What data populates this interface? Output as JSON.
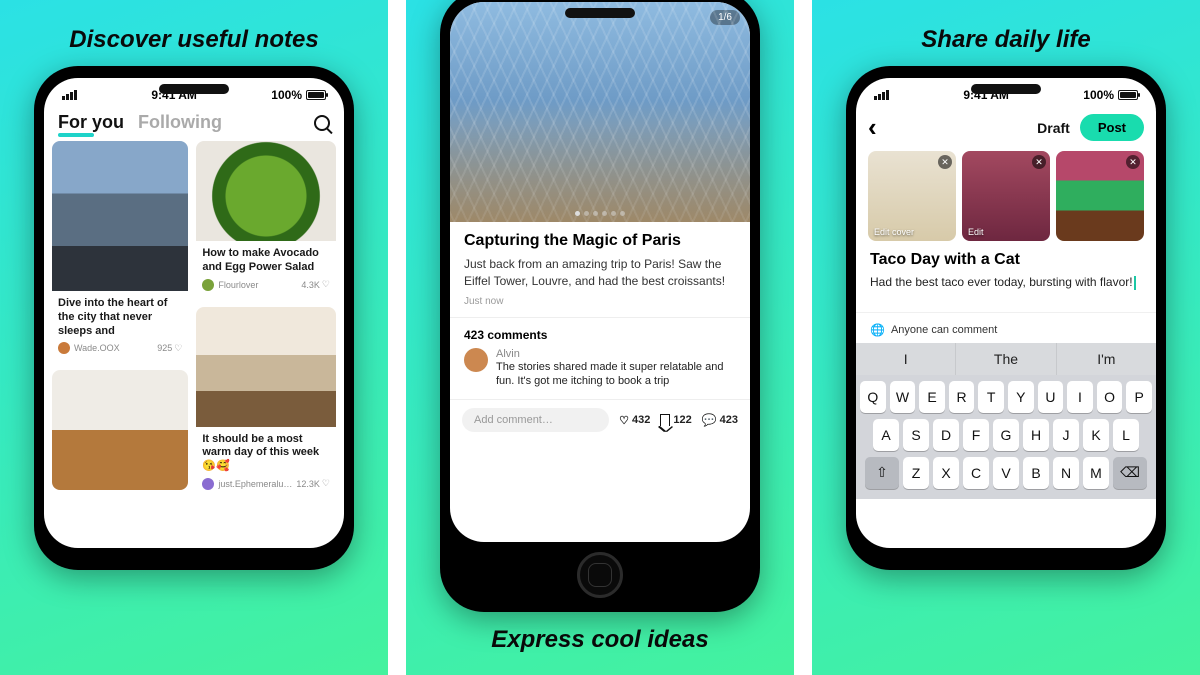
{
  "panels": {
    "left_headline": "Discover useful notes",
    "mid_headline": "Express cool ideas",
    "right_headline": "Share daily life"
  },
  "status": {
    "time": "9:41 AM",
    "battery": "100%"
  },
  "screen1": {
    "tabs": {
      "active": "For you",
      "inactive": "Following"
    },
    "cards": {
      "city": {
        "title": "Dive into the heart of the city that never sleeps and",
        "user": "Wade.OOX",
        "likes": "925"
      },
      "salad": {
        "title": "How to make Avocado and Egg Power Salad",
        "user": "Flourlover",
        "likes": "4.3K"
      },
      "room": {
        "title": "It should be a most warm day of this week 😘🥰",
        "user": "just.Ephemeralu…",
        "likes": "12.3K"
      }
    }
  },
  "screen2": {
    "counter": "1/6",
    "title": "Capturing the Magic of Paris",
    "text": "Just back from an amazing trip to Paris! Saw the Eiffel Tower, Louvre, and had the best croissants!",
    "time": "Just now",
    "comments_label": "423 comments",
    "comment": {
      "name": "Alvin",
      "text": "The stories shared made it super relatable and fun. It's got me itching to book a trip"
    },
    "add_placeholder": "Add comment…",
    "stats": {
      "likes": "432",
      "saves": "122",
      "comments": "423"
    }
  },
  "screen3": {
    "draft": "Draft",
    "post": "Post",
    "thumbs": {
      "edit_cover": "Edit cover",
      "edit": "Edit"
    },
    "title": "Taco Day with a Cat",
    "text": "Had the best taco ever today, bursting with flavor!",
    "visibility": "Anyone can comment",
    "suggest": {
      "a": "I",
      "b": "The",
      "c": "I'm"
    },
    "keys": {
      "r1": [
        "Q",
        "W",
        "E",
        "R",
        "T",
        "Y",
        "U",
        "I",
        "O",
        "P"
      ],
      "r2": [
        "A",
        "S",
        "D",
        "F",
        "G",
        "H",
        "J",
        "K",
        "L"
      ],
      "r3": [
        "Z",
        "X",
        "C",
        "V",
        "B",
        "N",
        "M"
      ]
    }
  }
}
